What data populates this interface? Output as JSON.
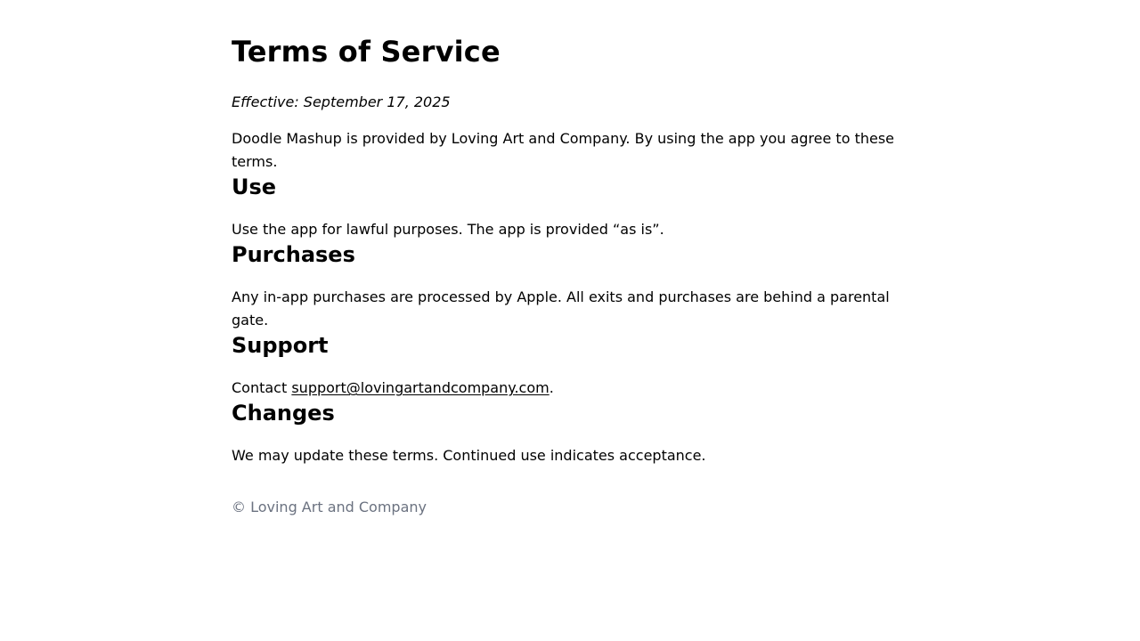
{
  "header": {
    "title": "Terms of Service",
    "effective": "Effective: September 17, 2025"
  },
  "intro": "Doodle Mashup is provided by Loving Art and Company. By using the app you agree to these terms.",
  "sections": [
    {
      "heading": "Use",
      "text": "Use the app for lawful purposes. The app is provided “as is”."
    },
    {
      "heading": "Purchases",
      "text": "Any in-app purchases are processed by Apple. All exits and purchases are behind a parental gate."
    },
    {
      "heading": "Support",
      "text_prefix": "Contact ",
      "email": "support@lovingartandcompany.com",
      "text_suffix": "."
    },
    {
      "heading": "Changes",
      "text": "We may update these terms. Continued use indicates acceptance."
    }
  ],
  "footer": {
    "copyright": "© Loving Art and Company"
  },
  "colors": {
    "text": "#000000",
    "footer_text": "#6b7280",
    "background": "#ffffff"
  }
}
